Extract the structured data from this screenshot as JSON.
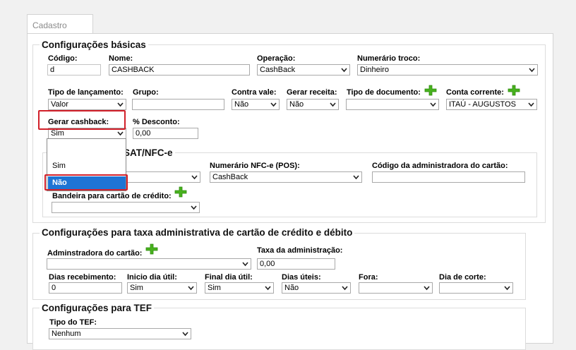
{
  "tab": {
    "label": "Cadastro"
  },
  "basic": {
    "legend": "Configurações básicas",
    "codigo": {
      "label": "Código:",
      "value": "d"
    },
    "nome": {
      "label": "Nome:",
      "value": "CASHBACK"
    },
    "operacao": {
      "label": "Operação:",
      "value": "CashBack"
    },
    "numerario_troco": {
      "label": "Numerário troco:",
      "value": "Dinheiro"
    },
    "tipo_lancamento": {
      "label": "Tipo de lançamento:",
      "value": "Valor"
    },
    "grupo": {
      "label": "Grupo:",
      "value": ""
    },
    "contra_vale": {
      "label": "Contra vale:",
      "value": "Não"
    },
    "gerar_receita": {
      "label": "Gerar receita:",
      "value": "Não"
    },
    "tipo_documento": {
      "label": "Tipo de documento:",
      "value": ""
    },
    "conta_corrente": {
      "label": "Conta corrente:",
      "value": "ITAÚ - AUGUSTOS"
    },
    "gerar_cashback": {
      "label": "Gerar cashback:",
      "value": "Sim",
      "options": [
        "",
        "Sim",
        "Não"
      ],
      "highlighted": "Não"
    },
    "desconto": {
      "label": "% Desconto:",
      "value": "0,00"
    }
  },
  "sat": {
    "legend": "SAT/NFC-e",
    "primeiro_select": {
      "value": ""
    },
    "numerario_nfce": {
      "label": "Numerário NFC-e (POS):",
      "value": "CashBack"
    },
    "codigo_admin": {
      "label": "Código da administradora do cartão:",
      "value": ""
    },
    "bandeira": {
      "label": "Bandeira para cartão de crédito:",
      "value": ""
    }
  },
  "taxa": {
    "legend": "Configurações para taxa administrativa de cartão de crédito e débito",
    "administradora": {
      "label": "Adminstradora do cartão:",
      "value": ""
    },
    "taxa_admin": {
      "label": "Taxa da administração:",
      "value": "0,00"
    },
    "dias_recebimento": {
      "label": "Dias recebimento:",
      "value": "0"
    },
    "inicio_dia_util": {
      "label": "Inicio dia útil:",
      "value": "Sim"
    },
    "final_dia_util": {
      "label": "Final dia útil:",
      "value": "Sim"
    },
    "dias_uteis": {
      "label": "Dias úteis:",
      "value": "Não"
    },
    "fora": {
      "label": "Fora:",
      "value": ""
    },
    "dia_corte": {
      "label": "Dia de corte:",
      "value": ""
    }
  },
  "tef": {
    "legend": "Configurações para TEF",
    "tipo_tef": {
      "label": "Tipo do TEF:",
      "value": "Nenhum"
    }
  },
  "colors": {
    "accent_red": "#d2202a",
    "highlight_blue": "#1e74d4",
    "plus_green": "#48b21e"
  },
  "icons": {
    "plus": "plus-icon",
    "arrow": "chevron-down-icon"
  }
}
